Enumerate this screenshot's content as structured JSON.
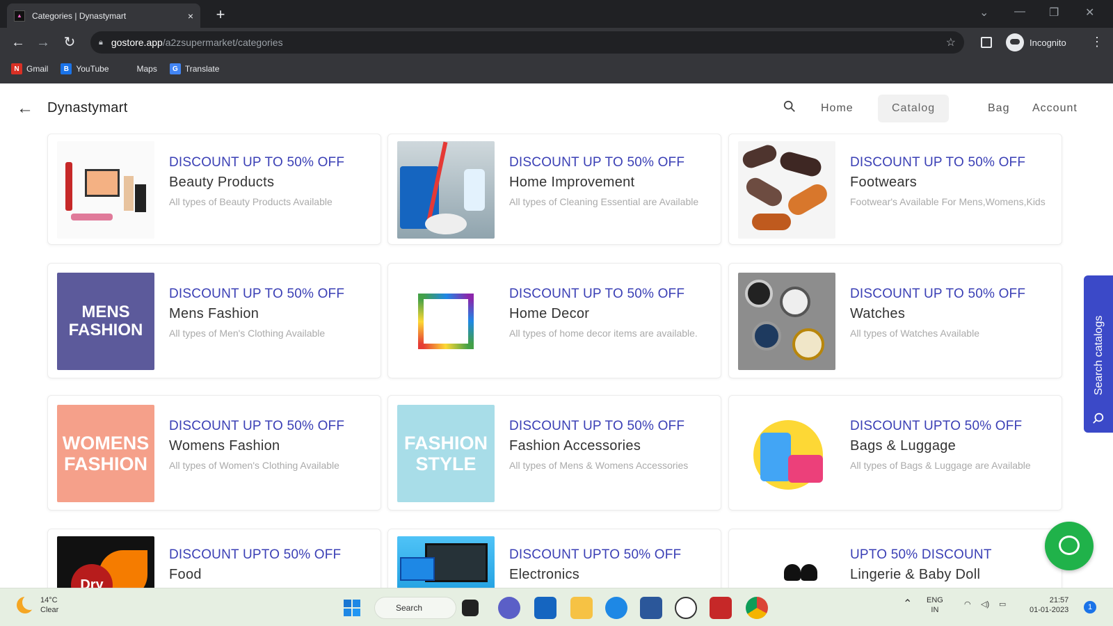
{
  "browser": {
    "tab_title": "Categories | Dynastymart",
    "new_tab": "+",
    "close_tab": "×",
    "url_host": "gostore.app",
    "url_path": "/a2zsupermarket/categories",
    "profile_label": "Incognito",
    "bookmarks": [
      {
        "label": "Gmail",
        "icon": "gmail-icon",
        "color": "#d93025",
        "glyph": "N"
      },
      {
        "label": "YouTube",
        "icon": "youtube-icon",
        "color": "#1a73e8",
        "glyph": "B"
      },
      {
        "label": "Maps",
        "icon": "maps-icon",
        "color": "#35363a",
        "glyph": ""
      },
      {
        "label": "Translate",
        "icon": "translate-icon",
        "color": "#4285f4",
        "glyph": "G"
      }
    ]
  },
  "app": {
    "brand": "Dynastymart",
    "nav": {
      "home": "Home",
      "catalog": "Catalog",
      "bag": "Bag",
      "account": "Account"
    },
    "side_tab_label": "Search catalogs",
    "accent_color": "#3a3fb5"
  },
  "categories": [
    {
      "discount": "DISCOUNT UP TO 50% OFF",
      "name": "Beauty Products",
      "desc": "All types of Beauty Products Available"
    },
    {
      "discount": "DISCOUNT UP TO 50% OFF",
      "name": "Home Improvement",
      "desc": "All types of Cleaning Essential are Available"
    },
    {
      "discount": "DISCOUNT UP TO 50% OFF",
      "name": "Footwears",
      "desc": "Footwear's Available For Mens,Womens,Kids"
    },
    {
      "discount": "DISCOUNT UP TO 50% OFF",
      "name": "Mens Fashion",
      "desc": "All types of Men's Clothing Available",
      "thumb_text_1": "MENS",
      "thumb_text_2": "FASHION"
    },
    {
      "discount": "DISCOUNT UP TO 50% OFF",
      "name": "Home Decor",
      "desc": "All types of home decor items are available."
    },
    {
      "discount": "DISCOUNT UP TO 50% OFF",
      "name": "Watches",
      "desc": "All types of Watches Available"
    },
    {
      "discount": "DISCOUNT UP TO 50% OFF",
      "name": "Womens Fashion",
      "desc": "All types of Women's Clothing Available",
      "thumb_text_1": "WOMENS",
      "thumb_text_2": "FASHION"
    },
    {
      "discount": "DISCOUNT UP TO 50% OFF",
      "name": "Fashion Accessories",
      "desc": "All types of Mens & Womens Accessories",
      "thumb_text_1": "FASHION",
      "thumb_text_2": "STYLE"
    },
    {
      "discount": "DISCOUNT UPTO 50% OFF",
      "name": "Bags & Luggage",
      "desc": "All types of Bags & Luggage are Available"
    },
    {
      "discount": "DISCOUNT UPTO 50% OFF",
      "name": "Food",
      "desc": "",
      "thumb_text_1": "Dry"
    },
    {
      "discount": "DISCOUNT UPTO 50% OFF",
      "name": "Electronics",
      "desc": ""
    },
    {
      "discount": "UPTO 50% DISCOUNT",
      "name": "Lingerie & Baby Doll",
      "desc": ""
    }
  ],
  "taskbar": {
    "weather_temp": "14°C",
    "weather_desc": "Clear",
    "search_label": "Search",
    "lang_1": "ENG",
    "lang_2": "IN",
    "time": "21:57",
    "date": "01-01-2023",
    "notification_count": "1"
  }
}
